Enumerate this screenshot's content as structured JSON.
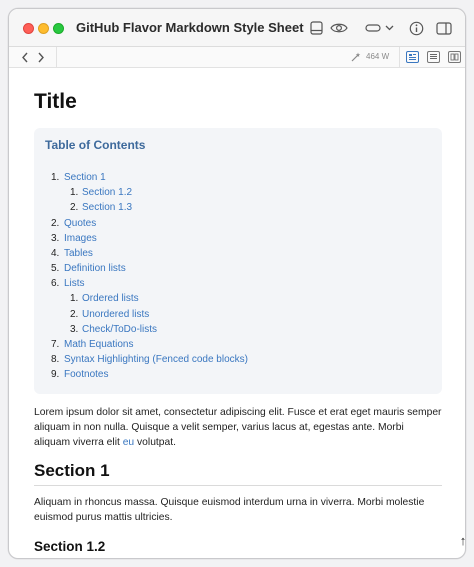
{
  "window": {
    "title": "GitHub Flavor Markdown Style Sheet"
  },
  "toolbar": {
    "width_readout": "464 W"
  },
  "document": {
    "title": "Title",
    "toc": {
      "heading": "Table of Contents",
      "items": [
        {
          "num": "1.",
          "label": "Section 1"
        },
        {
          "num": "1.",
          "label": "Section 1.2"
        },
        {
          "num": "2.",
          "label": "Section 1.3"
        },
        {
          "num": "2.",
          "label": "Quotes"
        },
        {
          "num": "3.",
          "label": "Images"
        },
        {
          "num": "4.",
          "label": "Tables"
        },
        {
          "num": "5.",
          "label": "Definition lists"
        },
        {
          "num": "6.",
          "label": "Lists"
        },
        {
          "num": "1.",
          "label": "Ordered lists"
        },
        {
          "num": "2.",
          "label": "Unordered lists"
        },
        {
          "num": "3.",
          "label": "Check/ToDo-lists"
        },
        {
          "num": "7.",
          "label": "Math Equations"
        },
        {
          "num": "8.",
          "label": "Syntax Highlighting (Fenced code blocks)"
        },
        {
          "num": "9.",
          "label": "Footnotes"
        }
      ]
    },
    "intro": {
      "text_before": "Lorem ipsum dolor sit amet, consectetur adipiscing elit. Fusce et erat eget mauris semper aliquam in non nulla. Quisque a velit semper, varius lacus at, egestas ante. Morbi aliquam viverra elit ",
      "link": "eu",
      "text_after": " volutpat."
    },
    "section1": {
      "heading": "Section 1",
      "text": "Aliquam in rhoncus massa. Quisque euismod interdum urna in viverra. Morbi molestie euismod purus mattis ultricies."
    },
    "section12": {
      "heading": "Section 1.2"
    },
    "scroll_top_glyph": "↑"
  },
  "colors": {
    "link": "#3a77c0",
    "toc_heading": "#3e6a9c",
    "toc_background": "#f3f5f8"
  }
}
